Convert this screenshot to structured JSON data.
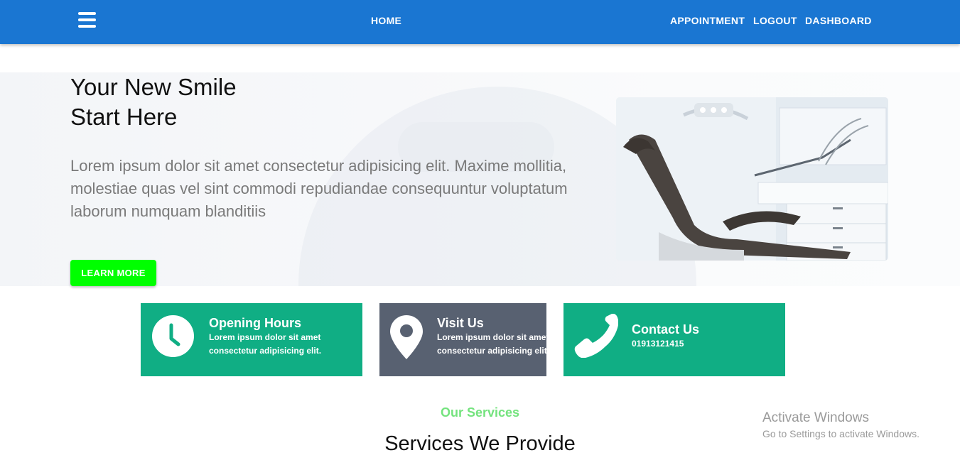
{
  "navbar": {
    "menu_icon": "hamburger-menu-icon",
    "home": "HOME",
    "appointment": "APPOINTMENT",
    "logout": "LOGOUT",
    "dashboard": "DASHBOARD",
    "color": "#1a76d2"
  },
  "hero": {
    "title_line1": "Your New Smile",
    "title_line2": "Start Here",
    "description": "Lorem ipsum dolor sit amet consectetur adipisicing elit. Maxime mollitia, molestiae quas vel sint commodi repudiandae consequuntur voluptatum laborum numquam blanditiis",
    "button_label": "LEARN MORE",
    "button_color": "#00ff00",
    "image": "dental-chair-photo"
  },
  "cards": [
    {
      "icon": "clock-icon",
      "title": "Opening Hours",
      "line1": "Lorem ipsum dolor sit amet",
      "line2": "consectetur adipisicing elit.",
      "color": "#10ae84"
    },
    {
      "icon": "map-pin-icon",
      "title": "Visit Us",
      "line1": "Lorem ipsum dolor sit amet",
      "line2": "consectetur adipisicing elit.",
      "color": "#586171"
    },
    {
      "icon": "phone-icon",
      "title": "Contact Us",
      "line1": "01913121415",
      "color": "#10ae84"
    }
  ],
  "services": {
    "kicker": "Our Services",
    "title": "Services We Provide",
    "kicker_color": "#74e37e"
  },
  "watermark": {
    "line1": "Activate Windows",
    "line2": "Go to Settings to activate Windows."
  }
}
